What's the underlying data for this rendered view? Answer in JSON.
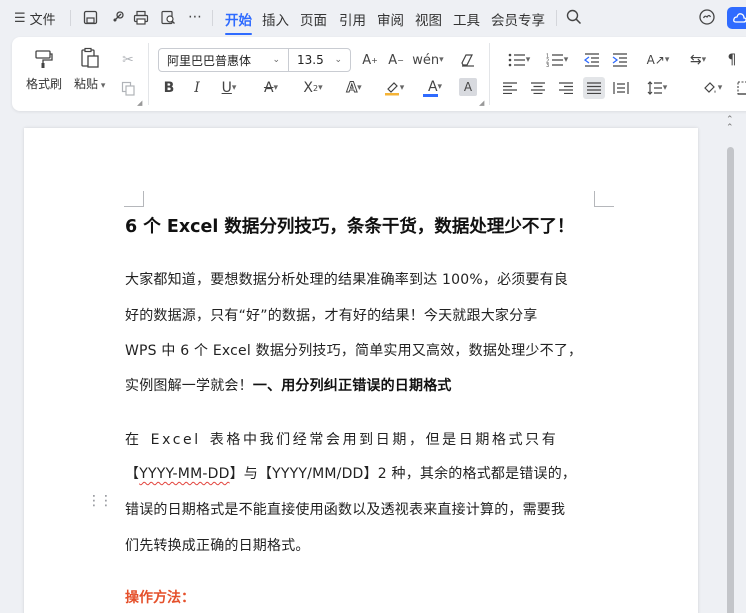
{
  "menubar": {
    "file_label": "文件",
    "tabs": [
      "开始",
      "插入",
      "页面",
      "引用",
      "审阅",
      "视图",
      "工具",
      "会员专享"
    ]
  },
  "ribbon": {
    "format_painter": "格式刷",
    "paste": "粘贴",
    "font_name": "阿里巴巴普惠体",
    "font_size": "13.5"
  },
  "document": {
    "title": "6 个 Excel 数据分列技巧，条条干货，数据处理少不了！",
    "p1_lines": [
      "大家都知道，要想数据分析处理的结果准确率到达 100%，必须要有良",
      "好的数据源，只有“好”的数据，才有好的结果！今天就跟大家分享",
      "WPS 中 6 个 Excel 数据分列技巧，简单实用又高效，数据处理少不了，"
    ],
    "p1_last": "实例图解一学就会！",
    "section_heading": "一、用分列纠正错误的日期格式",
    "p2_line1": "在  Excel  表格中我们经常会用到日期，但是日期格式只有",
    "p2_line2_a": "【",
    "p2_line2_code": "YYYY-MM-DD",
    "p2_line2_b": "】与【YYYY/MM/DD】2 种，其余的格式都是错误的，",
    "p2_line3": "错误的日期格式是不能直接使用函数以及透视表来直接计算的，需要我",
    "p2_line4": "们先转换成正确的日期格式。",
    "op_title": "操作方法："
  },
  "colors": {
    "accent": "#2f6bff",
    "op_title": "#e5502b"
  }
}
